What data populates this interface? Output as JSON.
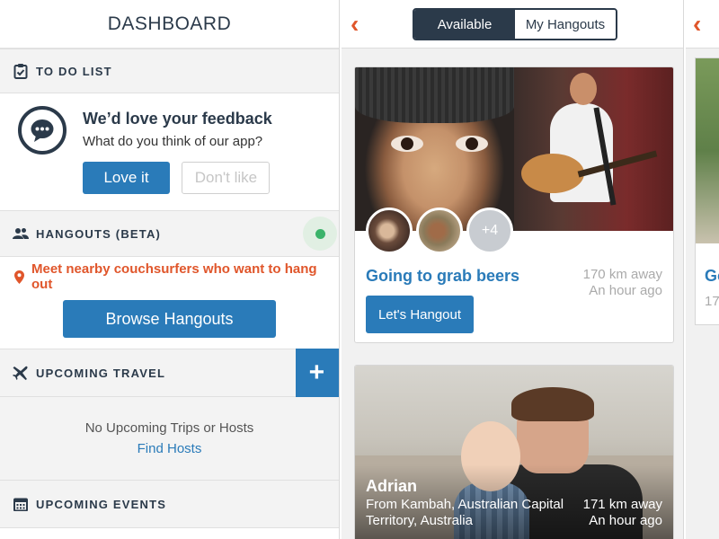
{
  "dashboard": {
    "title": "DASHBOARD",
    "todo": {
      "header": "TO DO LIST",
      "feedback_title": "We’d love your feedback",
      "feedback_sub": "What do you think of our app?",
      "love_label": "Love it",
      "dislike_label": "Don't like"
    },
    "hangouts": {
      "header": "HANGOUTS (BETA)",
      "meet_text": "Meet nearby couchsurfers who want to hang out",
      "browse_label": "Browse Hangouts"
    },
    "travel": {
      "header": "UPCOMING TRAVEL",
      "plus_label": "+",
      "empty_text": "No Upcoming Trips or Hosts",
      "find_hosts": "Find Hosts"
    },
    "events": {
      "header": "UPCOMING EVENTS"
    }
  },
  "hangouts_list": {
    "back": "‹",
    "tabs": [
      {
        "label": "Available",
        "active": true
      },
      {
        "label": "My Hangouts",
        "active": false
      }
    ],
    "cards": [
      {
        "title": "Going to grab beers",
        "distance": "170 km away",
        "time": "An hour ago",
        "extra_count": "+4",
        "button": "Let's Hangout"
      },
      {
        "name": "Adrian",
        "from": "From Kambah, Australian Capital Territory, Australia",
        "distance": "171 km away",
        "time": "An hour ago"
      }
    ]
  },
  "right_panel": {
    "back": "‹",
    "title_fragment": "Go",
    "meta_fragment": "17"
  },
  "colors": {
    "accent_blue": "#2a7bb9",
    "navy": "#2b3a4a",
    "orange": "#e0562b",
    "online_green": "#3bb36a"
  },
  "icons": [
    "clipboard-check-icon",
    "chat-bubble-icon",
    "people-icon",
    "location-pin-icon",
    "airplane-icon",
    "calendar-icon",
    "chevron-left-icon"
  ]
}
